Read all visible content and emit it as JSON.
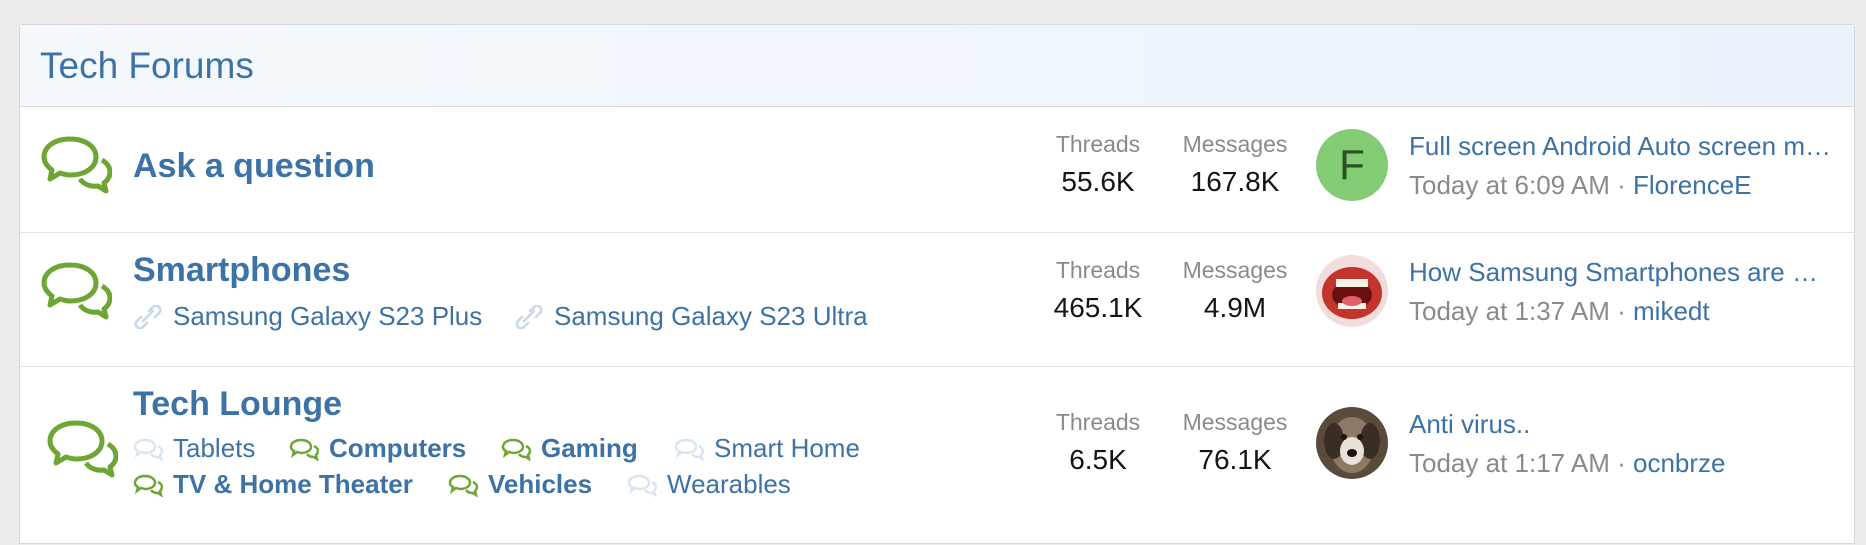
{
  "forum": {
    "title": "Tech Forums",
    "nodes": [
      {
        "title": "Ask a question",
        "stats": {
          "threads_label": "Threads",
          "threads": "55.6K",
          "messages_label": "Messages",
          "messages": "167.8K"
        },
        "latest": {
          "title": "Full screen Android Auto screen m…",
          "time": "Today at 6:09 AM",
          "sep": " · ",
          "user": "FlorenceE",
          "avatar_letter": "F",
          "avatar_color": "#84cc74"
        }
      },
      {
        "title": "Smartphones",
        "subforums": [
          "Samsung Galaxy S23 Plus",
          "Samsung Galaxy S23 Ultra"
        ],
        "stats": {
          "threads_label": "Threads",
          "threads": "465.1K",
          "messages_label": "Messages",
          "messages": "4.9M"
        },
        "latest": {
          "title": "How Samsung Smartphones are …",
          "time": "Today at 1:37 AM",
          "sep": " · ",
          "user": "mikedt"
        }
      },
      {
        "title": "Tech Lounge",
        "subforums": [
          "Tablets",
          "Computers",
          "Gaming",
          "Smart Home",
          "TV & Home Theater",
          "Vehicles",
          "Wearables"
        ],
        "stats": {
          "threads_label": "Threads",
          "threads": "6.5K",
          "messages_label": "Messages",
          "messages": "76.1K"
        },
        "latest": {
          "title": "Anti virus..",
          "time": "Today at 1:17 AM",
          "sep": " · ",
          "user": "ocnbrze"
        }
      }
    ]
  },
  "colors": {
    "accent": "#3d72a6",
    "icon_unread": "#6ea634",
    "icon_read": "#d8e6f3"
  }
}
